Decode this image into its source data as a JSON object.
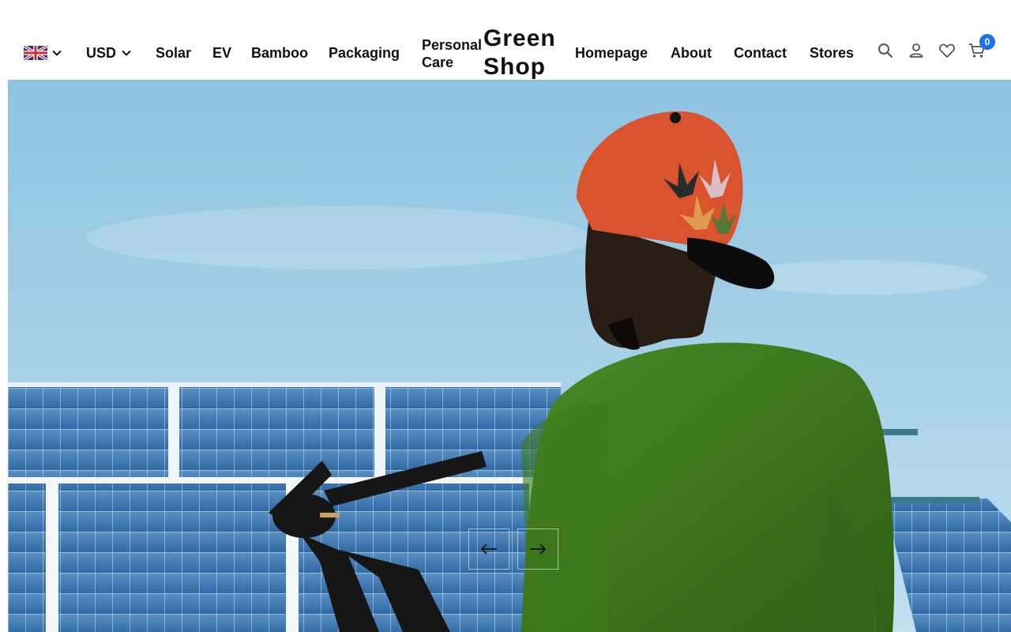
{
  "header": {
    "language_icon": "uk-flag-icon",
    "currency": "USD",
    "nav_left": [
      "Solar",
      "EV",
      "Bamboo",
      "Packaging"
    ],
    "personal_care": [
      "Personal",
      "Care"
    ],
    "brand": [
      "Green",
      "Shop"
    ],
    "nav_right": [
      "Homepage",
      "About",
      "Contact",
      "Stores"
    ],
    "icons": [
      "search-icon",
      "account-icon",
      "heart-icon",
      "cart-icon"
    ],
    "cart_count": "0"
  },
  "hero": {
    "image": "man-in-red-cap-and-green-shirt-facing-solar-panels",
    "prev_icon": "arrow-left-icon",
    "next_icon": "arrow-right-icon"
  },
  "colors": {
    "badge": "#1a73e8",
    "sky": "#9fcbe4",
    "shirt": "#3f7a1f",
    "cap": "#d9532e",
    "panel": "#3f78b0"
  }
}
